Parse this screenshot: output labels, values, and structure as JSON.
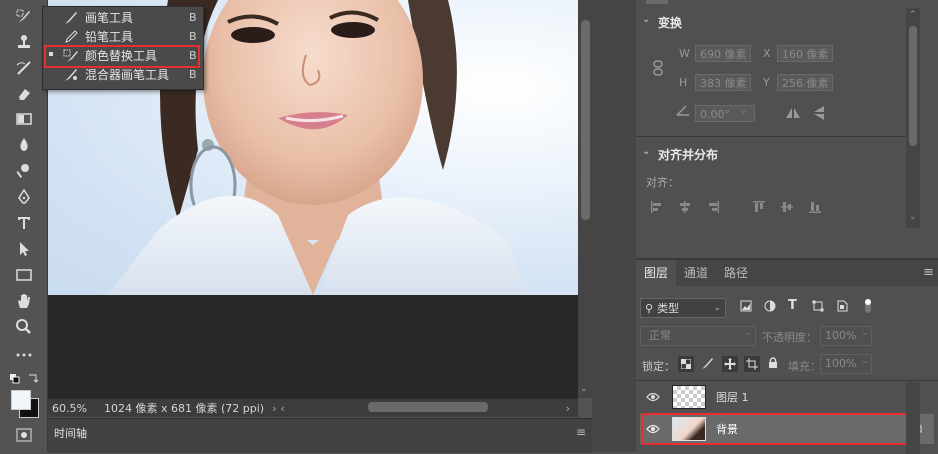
{
  "tool_flyout": {
    "items": [
      {
        "label": "画笔工具",
        "shortcut": "B",
        "active": false
      },
      {
        "label": "铅笔工具",
        "shortcut": "B",
        "active": false
      },
      {
        "label": "颜色替换工具",
        "shortcut": "B",
        "active": true
      },
      {
        "label": "混合器画笔工具",
        "shortcut": "B",
        "active": false
      }
    ]
  },
  "status": {
    "zoom": "60.5%",
    "doc_info": "1024 像素 x 681 像素 (72 ppi)"
  },
  "timeline": {
    "title": "时间轴"
  },
  "properties": {
    "transform_title": "变换",
    "w_label": "W",
    "w_value": "690 像素",
    "x_label": "X",
    "x_value": "160 像素",
    "h_label": "H",
    "h_value": "383 像素",
    "y_label": "Y",
    "y_value": "256 像素",
    "angle_value": "0.00°",
    "align_title": "对齐并分布",
    "align_label": "对齐："
  },
  "layers_panel": {
    "tabs": [
      "图层",
      "通道",
      "路径"
    ],
    "kind_filter": "类型",
    "blend_mode": "正常",
    "opacity_label": "不透明度：",
    "opacity_value": "100%",
    "lock_label": "锁定：",
    "fill_label": "填充：",
    "fill_value": "100%",
    "layers": [
      {
        "name": "图层 1",
        "selected": false
      },
      {
        "name": "背景",
        "selected": true
      }
    ]
  },
  "colors": {
    "accent_red": "#e63030",
    "panel_bg": "#505050",
    "canvas_bg": "#282828"
  }
}
